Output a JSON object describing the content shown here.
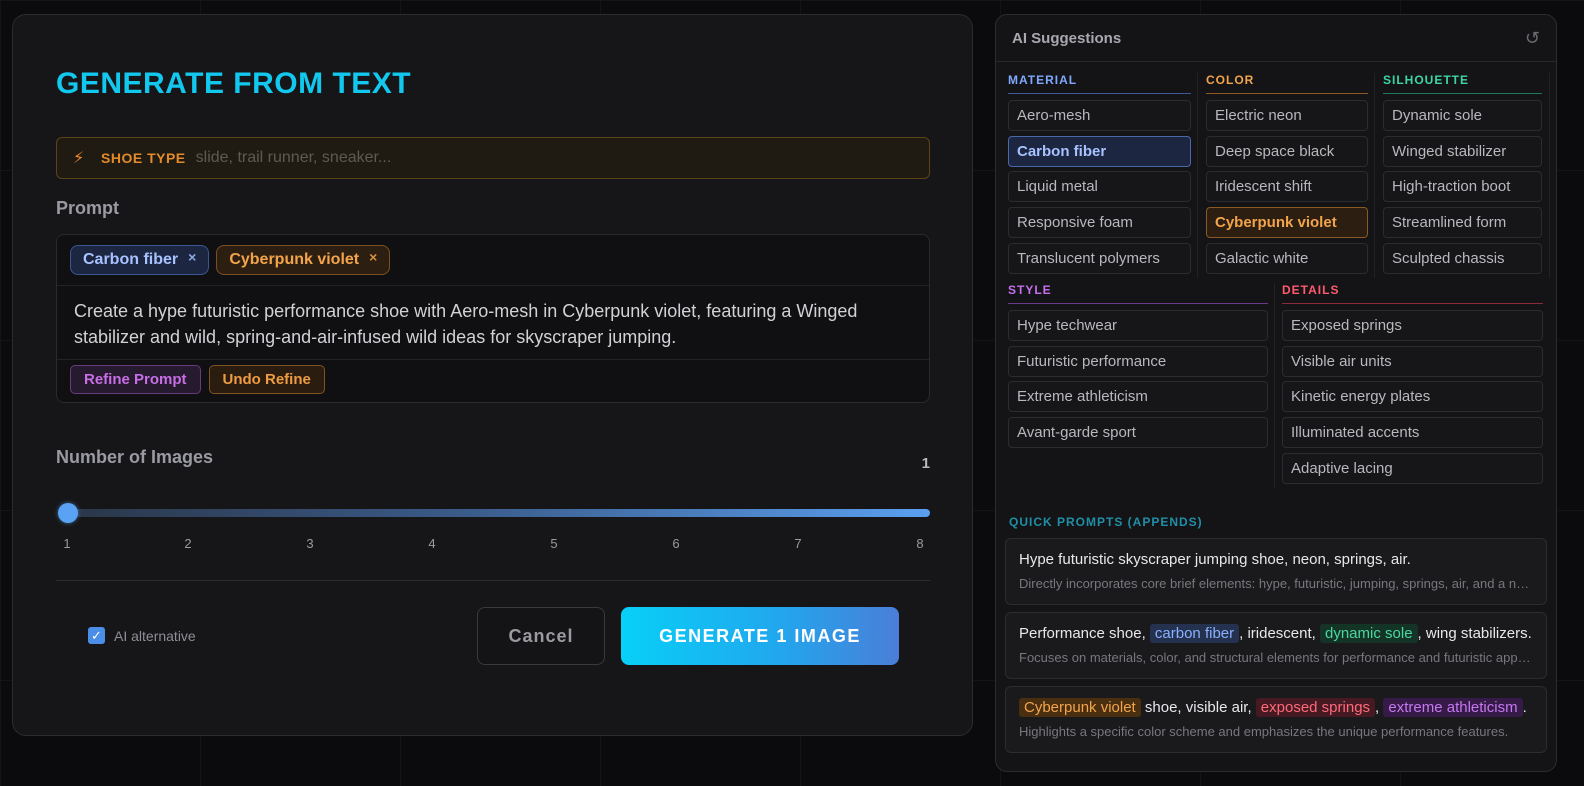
{
  "generator": {
    "title": "GENERATE FROM TEXT",
    "shoe_type": {
      "label": "SHOE TYPE",
      "placeholder": "slide, trail runner, sneaker...",
      "value": ""
    },
    "prompt": {
      "label": "Prompt",
      "chips": [
        {
          "label": "Carbon fiber",
          "remove_icon": "×"
        },
        {
          "label": "Cyberpunk violet",
          "remove_icon": "×"
        }
      ],
      "text": "Create a hype futuristic performance shoe with Aero-mesh in Cyberpunk violet, featuring a Winged stabilizer and wild, spring-and-air-infused wild ideas for skyscraper jumping.",
      "refine_label": "Refine Prompt",
      "undo_label": "Undo Refine"
    },
    "num_images": {
      "label": "Number of Images",
      "value": 1,
      "value_text": "1",
      "min": 1,
      "max": 8,
      "ticks": [
        "1",
        "2",
        "3",
        "4",
        "5",
        "6",
        "7",
        "8"
      ]
    },
    "ai_alternative": {
      "label": "AI alternative",
      "checked": true
    },
    "cancel_label": "Cancel",
    "generate_label": "GENERATE 1 IMAGE"
  },
  "suggestions": {
    "title": "AI Suggestions",
    "refresh_icon": "refresh-icon",
    "material": {
      "title": "MATERIAL",
      "items": [
        "Aero-mesh",
        "Carbon fiber",
        "Liquid metal",
        "Responsive foam",
        "Translucent polymers"
      ],
      "selected": "Carbon fiber"
    },
    "color": {
      "title": "COLOR",
      "items": [
        "Electric neon",
        "Deep space black",
        "Iridescent shift",
        "Cyberpunk violet",
        "Galactic white"
      ],
      "selected": "Cyberpunk violet"
    },
    "silhouette": {
      "title": "SILHOUETTE",
      "items": [
        "Dynamic sole",
        "Winged stabilizer",
        "High-traction boot",
        "Streamlined form",
        "Sculpted chassis"
      ]
    },
    "style": {
      "title": "STYLE",
      "items": [
        "Hype techwear",
        "Futuristic performance",
        "Extreme athleticism",
        "Avant-garde sport"
      ]
    },
    "details": {
      "title": "DETAILS",
      "items": [
        "Exposed springs",
        "Visible air units",
        "Kinetic energy plates",
        "Illuminated accents",
        "Adaptive lacing"
      ]
    },
    "quick_prompts": {
      "title": "QUICK PROMPTS (APPENDS)",
      "items": [
        {
          "main": "Hype futuristic skyscraper jumping shoe, neon, springs, air.",
          "sub": "Directly incorporates core brief elements: hype, futuristic, jumping, springs, air, and a neon color scheme."
        },
        {
          "p1": "Performance shoe, ",
          "h1": "carbon fiber",
          "p2": ", iridescent, ",
          "h2": "dynamic sole",
          "p3": ", wing stabilizers.",
          "sub": "Focuses on materials, color, and structural elements for performance and futuristic appeal."
        },
        {
          "h1": "Cyberpunk violet",
          "p1": " shoe, visible air, ",
          "h2": "exposed springs",
          "p2": ", ",
          "h3": "extreme athleticism",
          "p3": ".",
          "sub": "Highlights a specific color scheme and emphasizes the unique performance features."
        }
      ]
    }
  },
  "colors": {
    "accent_cyan": "#12c8ee",
    "material": "#7fa8ff",
    "color": "#f2a44c",
    "silhouette": "#3ed6a0",
    "style": "#c66ef0",
    "details": "#ff5a6e"
  }
}
